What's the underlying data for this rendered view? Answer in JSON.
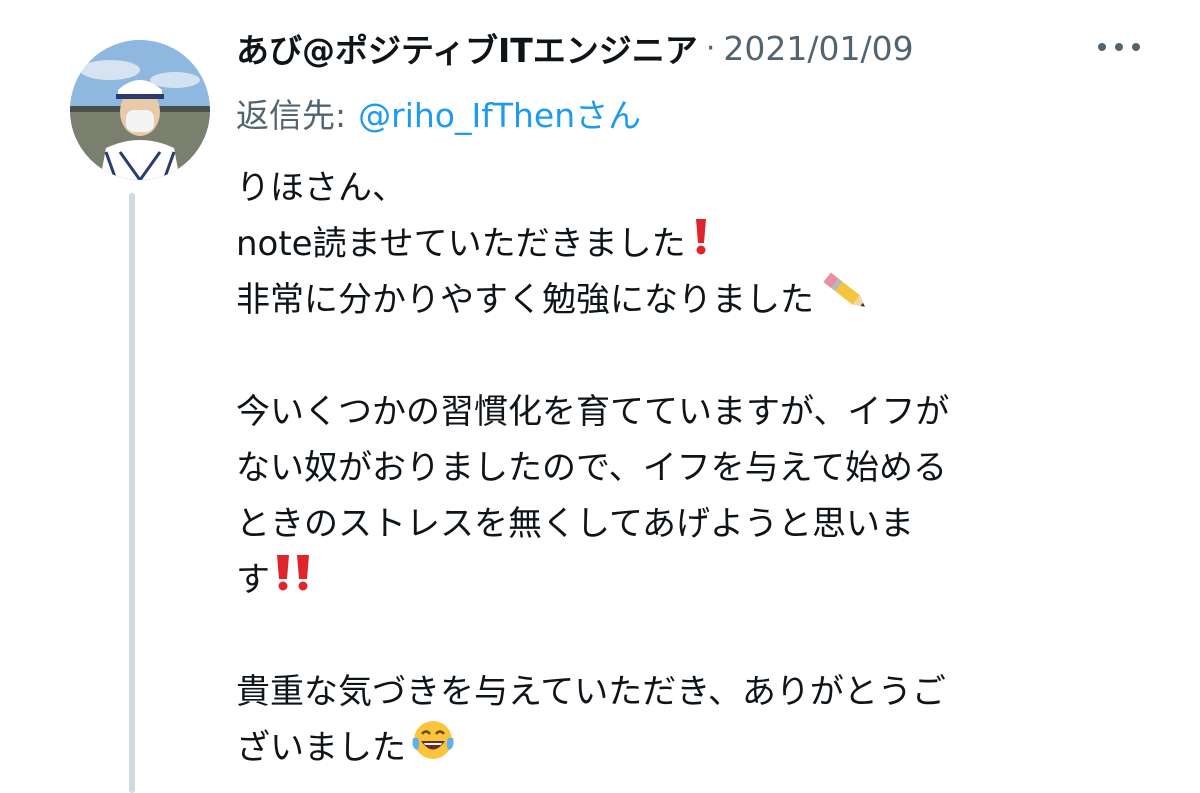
{
  "tweet": {
    "author_name": "あび@ポジティブITエンジニア",
    "separator": "·",
    "date": "2021/01/09",
    "more_icon": "more-horizontal-icon",
    "reply_label": "返信先:",
    "reply_handle": "@riho_IfThen",
    "reply_suffix": "さん",
    "lines": [
      "りほさん、",
      "note読ませていただきました",
      "非常に分かりやすく勉強になりました",
      "",
      "今いくつかの習慣化を育てていますが、イフが",
      "ない奴がおりましたので、イフを与えて始める",
      "ときのストレスを無くしてあげようと思いま",
      "す",
      "",
      "貴重な気づきを与えていただき、ありがとうご",
      "ざいました"
    ],
    "emojis": {
      "exclamation": "exclamation-mark-icon",
      "pencil": "pencil-icon",
      "double_exclamation": "double-exclamation-icon",
      "laughing": "face-with-tears-of-joy-icon"
    },
    "colors": {
      "text": "#0f1419",
      "muted": "#536471",
      "link": "#1d9bf0",
      "thread_line": "#cfd9de"
    }
  }
}
